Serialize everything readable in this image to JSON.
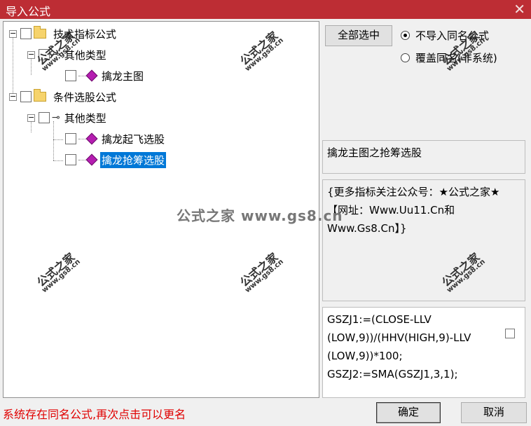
{
  "window": {
    "title": "导入公式",
    "close_glyph": "✕"
  },
  "tree": {
    "group1": {
      "label": "技术指标公式",
      "sub": {
        "label": "其他类型",
        "items": [
          "擒龙主图"
        ]
      }
    },
    "group2": {
      "label": "条件选股公式",
      "sub": {
        "label": "其他类型",
        "items": [
          "擒龙起飞选股",
          "擒龙抢筹选股"
        ]
      }
    },
    "expander_glyph": "−"
  },
  "options": {
    "select_all_label": "全部选中",
    "radio1_label": "不导入同名公式",
    "radio2_label": "覆盖同名(非系统)",
    "radio_selected": 1
  },
  "info": {
    "name": "擒龙主图之抢筹选股",
    "description": "{更多指标关注公众号：★公式之家★ 【网址：Www.Uu11.Cn和Www.Gs8.Cn】}",
    "formula_lines": [
      "GSZJ1:=(CLOSE-LLV",
      "(LOW,9))/(HHV(HIGH,9)-LLV",
      "(LOW,9))*100;",
      "GSZJ2:=SMA(GSZJ1,3,1);"
    ]
  },
  "status_text": "系统存在同名公式,再次点击可以更名",
  "buttons": {
    "ok": "确定",
    "cancel": "取消"
  },
  "watermark": {
    "line1": "公式之家",
    "line2": "www.gs8.cn",
    "center": "公式之家 www.gs8.cn"
  },
  "colors": {
    "titlebar": "#bd2d34",
    "selection": "#0078d7",
    "status": "#e00000"
  }
}
